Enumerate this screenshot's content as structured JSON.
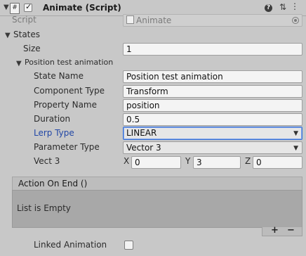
{
  "component": {
    "title": "Animate (Script)",
    "enabled": true,
    "script_label": "Script",
    "script_value": "Animate"
  },
  "states": {
    "label": "States",
    "size_label": "Size",
    "size_value": "1",
    "element": {
      "title": "Position test animation",
      "state_name_label": "State Name",
      "state_name_value": "Position test animation",
      "component_type_label": "Component Type",
      "component_type_value": "Transform",
      "property_name_label": "Property Name",
      "property_name_value": "position",
      "duration_label": "Duration",
      "duration_value": "0.5",
      "lerp_type_label": "Lerp Type",
      "lerp_type_value": "LINEAR",
      "parameter_type_label": "Parameter Type",
      "parameter_type_value": "Vector 3",
      "vect3_label": "Vect 3",
      "x_label": "X",
      "x_value": "0",
      "y_label": "Y",
      "y_value": "3",
      "z_label": "Z",
      "z_value": "0"
    }
  },
  "action_on_end": {
    "title": "Action On End ()",
    "empty_text": "List is Empty",
    "add_label": "+",
    "remove_label": "−"
  },
  "linked_animation": {
    "label": "Linked Animation",
    "checked": false
  },
  "header_icons": [
    "help-icon",
    "preset-icon",
    "more-icon"
  ]
}
